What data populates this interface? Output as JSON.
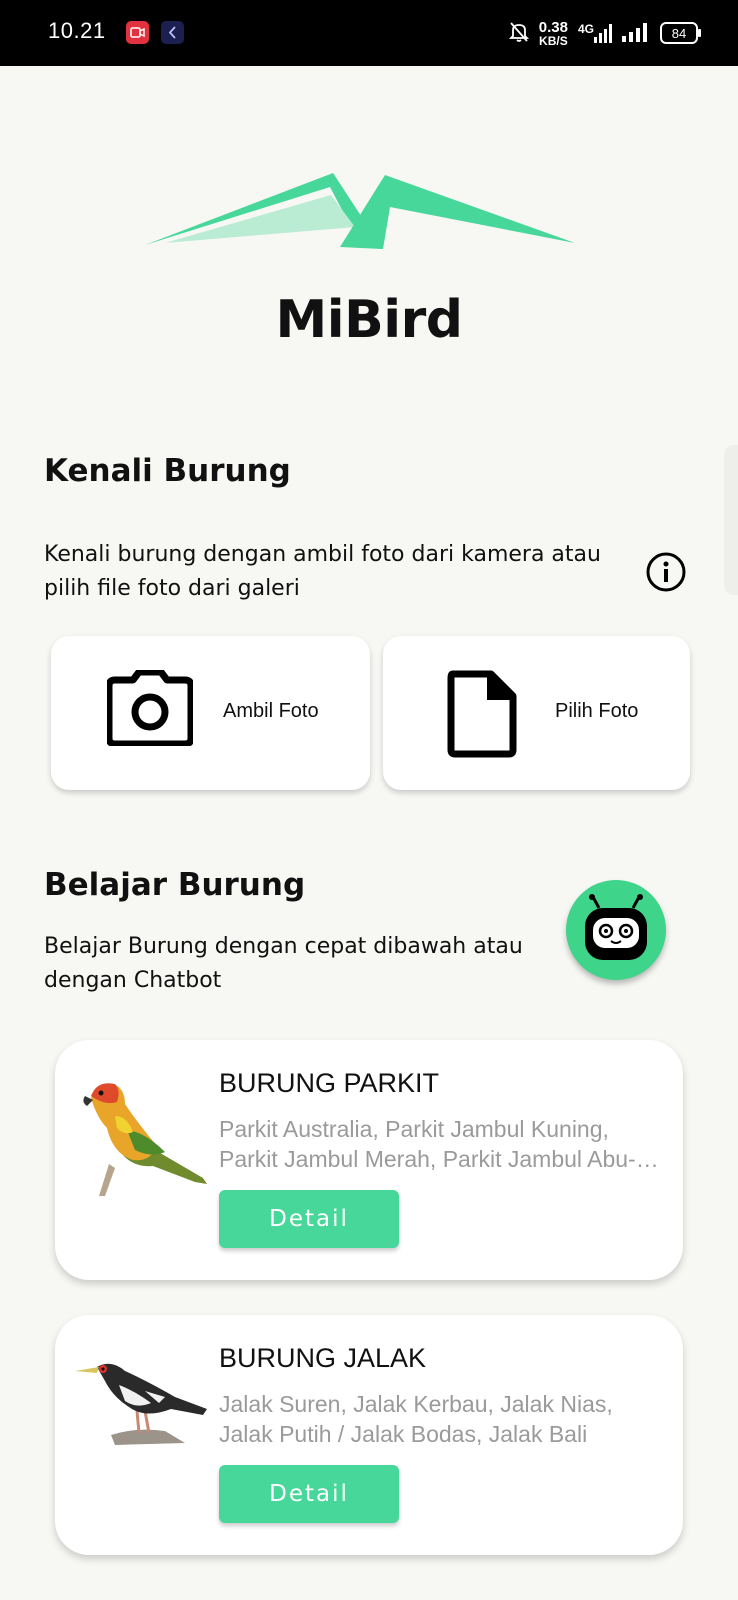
{
  "status_bar": {
    "time": "10.21",
    "net_speed_value": "0.38",
    "net_speed_unit": "KB/S",
    "network_type": "4G",
    "battery": "84"
  },
  "app": {
    "title": "MiBird",
    "accent_color": "#47d79a"
  },
  "identify": {
    "title": "Kenali Burung",
    "description": "Kenali burung dengan ambil foto dari kamera atau pilih file foto dari galeri",
    "camera_label": "Ambil Foto",
    "gallery_label": "Pilih Foto",
    "info_icon": "info-icon"
  },
  "learn": {
    "title": "Belajar Burung",
    "description": "Belajar Burung dengan cepat dibawah atau dengan Chatbot",
    "chatbot_icon": "robot-icon"
  },
  "birds": [
    {
      "name": "BURUNG PARKIT",
      "description": "Parkit Australia, Parkit Jambul Kuning, Parkit Jambul Merah, Parkit Jambul Abu-abu",
      "button_label": "Detail"
    },
    {
      "name": "BURUNG JALAK",
      "description": "Jalak Suren, Jalak Kerbau, Jalak Nias, Jalak Putih / Jalak Bodas, Jalak Bali",
      "button_label": "Detail"
    }
  ]
}
